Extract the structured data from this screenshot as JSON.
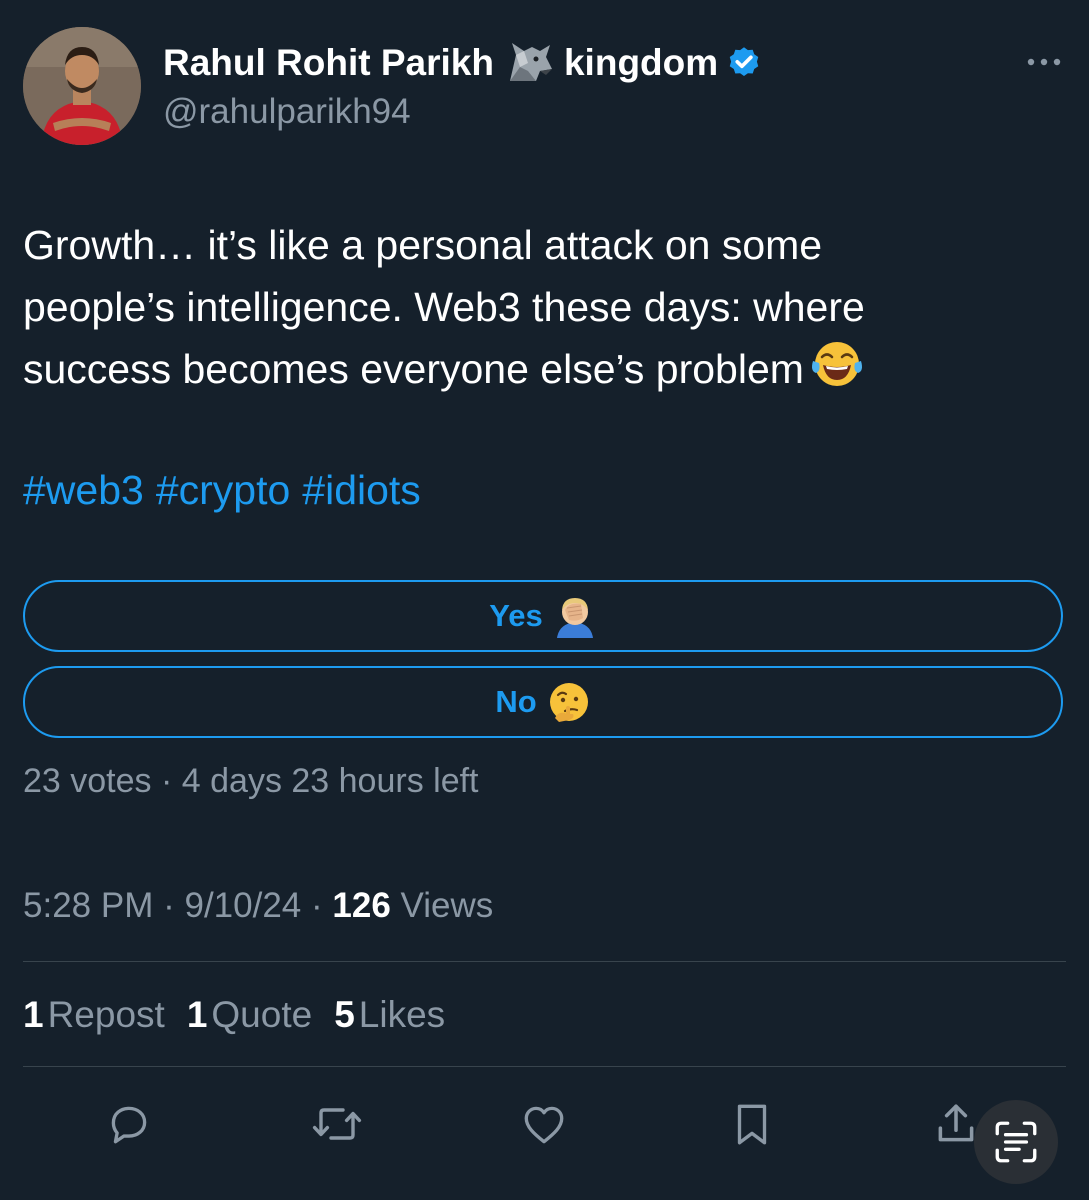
{
  "author": {
    "name": "Rahul Rohit Parikh",
    "name_suffix": "kingdom",
    "handle": "@rahulparikh94",
    "name_emoji": "wolf-icon",
    "verified": true
  },
  "tweet": {
    "lines": [
      "Growth… it’s like a personal attack on some",
      "people’s intelligence. Web3 these days: where",
      "success becomes everyone else’s problem"
    ],
    "trailing_emoji": "face-with-tears-of-joy-icon",
    "hashtags": [
      "#web3",
      "#crypto",
      "#idiots"
    ]
  },
  "poll": {
    "options": [
      {
        "label": "Yes",
        "emoji": "face-palm-icon"
      },
      {
        "label": "No",
        "emoji": "thinking-face-icon"
      }
    ],
    "votes": "23 votes",
    "separator": "·",
    "time_left": "4 days 23 hours left"
  },
  "meta": {
    "time": "5:28 PM",
    "date": "9/10/24",
    "separator": "·",
    "views_count": "126",
    "views_label": "Views"
  },
  "stats": {
    "reposts_count": "1",
    "reposts_label": "Repost",
    "quotes_count": "1",
    "quotes_label": "Quote",
    "likes_count": "5",
    "likes_label": "Likes"
  },
  "colors": {
    "background": "#15202b",
    "accent": "#1d9bf0",
    "muted": "#8b98a5",
    "divider": "#38444d"
  }
}
